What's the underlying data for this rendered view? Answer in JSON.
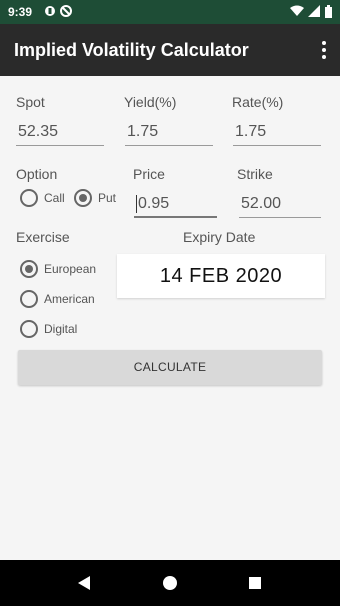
{
  "status_bar": {
    "time": "9:39"
  },
  "app_bar": {
    "title": "Implied Volatility Calculator"
  },
  "spot": {
    "label": "Spot",
    "value": "52.35"
  },
  "yield": {
    "label": "Yield(%)",
    "value": "1.75"
  },
  "rate": {
    "label": "Rate(%)",
    "value": "1.75"
  },
  "option": {
    "label": "Option",
    "call_label": "Call",
    "put_label": "Put",
    "selected": "Put"
  },
  "price": {
    "label": "Price",
    "value": "0.95"
  },
  "strike": {
    "label": "Strike",
    "value": "52.00"
  },
  "exercise": {
    "label": "Exercise",
    "options": [
      "European",
      "American",
      "Digital"
    ],
    "selected": "European"
  },
  "expiry": {
    "label": "Expiry Date",
    "value": "14 FEB 2020"
  },
  "calculate_label": "CALCULATE",
  "colors": {
    "status_bar": "#1e4d36",
    "app_bar": "#2a2a2a",
    "background": "#f5f5f5",
    "button": "#d9d9d9"
  },
  "icons": [
    "wifi-icon",
    "signal-icon",
    "battery-icon",
    "overflow-menu-icon",
    "back-icon",
    "home-icon",
    "recents-icon"
  ]
}
